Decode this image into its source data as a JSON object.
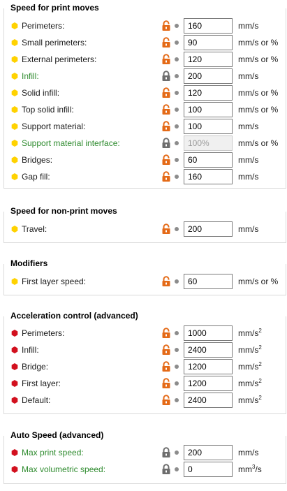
{
  "colors": {
    "orange_lock": "#e46a17",
    "gray_lock": "#6d6d6d",
    "yellow_bullet": "#ffd200",
    "red_bullet": "#d2101e",
    "green_label": "#2e8b2e"
  },
  "sections": [
    {
      "title": "Speed for print moves",
      "rows": [
        {
          "label": "Perimeters:",
          "value": "160",
          "unit": "mm/s",
          "bullet": "yellow",
          "lock": "unlocked"
        },
        {
          "label": "Small perimeters:",
          "value": "90",
          "unit": "mm/s or %",
          "bullet": "yellow",
          "lock": "unlocked"
        },
        {
          "label": "External perimeters:",
          "value": "120",
          "unit": "mm/s or %",
          "bullet": "yellow",
          "lock": "unlocked"
        },
        {
          "label": "Infill:",
          "value": "200",
          "unit": "mm/s",
          "bullet": "yellow",
          "lock": "locked",
          "green": true
        },
        {
          "label": "Solid infill:",
          "value": "120",
          "unit": "mm/s or %",
          "bullet": "yellow",
          "lock": "unlocked"
        },
        {
          "label": "Top solid infill:",
          "value": "100",
          "unit": "mm/s or %",
          "bullet": "yellow",
          "lock": "unlocked"
        },
        {
          "label": "Support material:",
          "value": "100",
          "unit": "mm/s",
          "bullet": "yellow",
          "lock": "unlocked"
        },
        {
          "label": "Support material interface:",
          "value": "100%",
          "unit": "mm/s or %",
          "bullet": "yellow",
          "lock": "locked",
          "green": true,
          "disabled": true
        },
        {
          "label": "Bridges:",
          "value": "60",
          "unit": "mm/s",
          "bullet": "yellow",
          "lock": "unlocked"
        },
        {
          "label": "Gap fill:",
          "value": "160",
          "unit": "mm/s",
          "bullet": "yellow",
          "lock": "unlocked"
        }
      ]
    },
    {
      "title": "Speed for non-print moves",
      "rows": [
        {
          "label": "Travel:",
          "value": "200",
          "unit": "mm/s",
          "bullet": "yellow",
          "lock": "unlocked"
        }
      ]
    },
    {
      "title": "Modifiers",
      "rows": [
        {
          "label": "First layer speed:",
          "value": "60",
          "unit": "mm/s or %",
          "bullet": "yellow",
          "lock": "unlocked"
        }
      ]
    },
    {
      "title": "Acceleration control (advanced)",
      "rows": [
        {
          "label": "Perimeters:",
          "value": "1000",
          "unit": "mm/s",
          "sup": "2",
          "bullet": "red",
          "lock": "unlocked"
        },
        {
          "label": "Infill:",
          "value": "2400",
          "unit": "mm/s",
          "sup": "2",
          "bullet": "red",
          "lock": "unlocked"
        },
        {
          "label": "Bridge:",
          "value": "1200",
          "unit": "mm/s",
          "sup": "2",
          "bullet": "red",
          "lock": "unlocked"
        },
        {
          "label": "First layer:",
          "value": "1200",
          "unit": "mm/s",
          "sup": "2",
          "bullet": "red",
          "lock": "unlocked"
        },
        {
          "label": "Default:",
          "value": "2400",
          "unit": "mm/s",
          "sup": "2",
          "bullet": "red",
          "lock": "unlocked"
        }
      ]
    },
    {
      "title": "Auto Speed (advanced)",
      "rows": [
        {
          "label": "Max print speed:",
          "value": "200",
          "unit": "mm/s",
          "bullet": "red",
          "lock": "locked",
          "green": true
        },
        {
          "label": "Max volumetric speed:",
          "value": "0",
          "unit": "mm",
          "sup": "3",
          "unit_suffix": "/s",
          "bullet": "red",
          "lock": "locked",
          "green": true
        }
      ]
    }
  ]
}
